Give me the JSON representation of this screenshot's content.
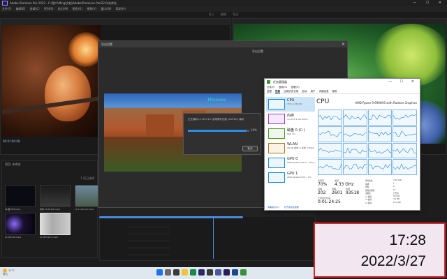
{
  "premiere": {
    "title": "Adobe Premiere Pro 2022 - C:\\用户\\Ming\\文档\\Adobe\\Premiere Pro\\22.0\\未命名",
    "window_buttons": "— ☐ ✕",
    "menu": [
      "文件(F)",
      "编辑(E)",
      "剪辑(C)",
      "序列(S)",
      "标记(M)",
      "图形(G)",
      "视图(V)",
      "窗口(W)",
      "帮助(H)"
    ],
    "workspaces": [
      "导入",
      "编辑",
      "导出"
    ],
    "source_timecode": "00:01:00:08",
    "project_title": "项目: 未命名",
    "item_count": "1 项已选择",
    "thumbs": [
      {
        "label": "IN-图.VEO.mp4"
      },
      {
        "label": "蒙版 LR-IM.JPG.mp4"
      },
      {
        "label": "YL-1 LR1 sim.mp4"
      },
      {
        "label": "LC-IM-V16.mp4"
      },
      {
        "label": "LC-IM-V16-2.mp4"
      }
    ]
  },
  "export_dialog": {
    "title": "导出设置",
    "close": "✕",
    "image_logo": "Hisense",
    "right_header": "导出设置"
  },
  "encoding": {
    "title": "正在编码 LC-IM-V16: 使用硬件加速 (NVENC) 编码",
    "percent_text": "18%",
    "progress": 0.96,
    "cancel": "取消"
  },
  "taskmgr": {
    "title": "任务管理器",
    "window_buttons": "— ☐ ✕",
    "menu": [
      "文件(F)",
      "选项(O)",
      "查看(V)"
    ],
    "tabs": [
      "进程",
      "性能",
      "应用历史记录",
      "启动",
      "用户",
      "详细信息",
      "服务"
    ],
    "active_tab": 1,
    "side": [
      {
        "name": "CPU",
        "sub": "70%  4.33 GHz",
        "kind": "cpu"
      },
      {
        "name": "内存",
        "sub": "12.0/15.2 GB (80%)",
        "kind": "mem"
      },
      {
        "name": "磁盘 0 (C:)",
        "sub": "SSD\n1%",
        "kind": "disk"
      },
      {
        "name": "WLAN",
        "sub": "WLAN\n发送: 0 接收: 0 Kbps",
        "kind": "wlan"
      },
      {
        "name": "GPU 0",
        "sub": "AMD Radeon RX 6...\n15% (75 °C)",
        "kind": "gpu"
      },
      {
        "name": "GPU 1",
        "sub": "AMD Radeon(TM)...\n1%",
        "kind": "gpu"
      }
    ],
    "cpu_header": "CPU",
    "cpu_name": "AMD Ryzen 9 6900HS with Radeon Graphics",
    "stats": {
      "util_label": "利用率",
      "util": "70%",
      "speed_label": "速度",
      "speed": "4.33 GHz",
      "proc_label": "进程",
      "proc": "202",
      "threads_label": "线程",
      "threads": "2601",
      "handles_label": "句柄",
      "handles": "93518",
      "uptime_label": "正常运行时间",
      "uptime": "0:01:24:25"
    },
    "specs": [
      [
        "基准速度:",
        "3.30 GHz"
      ],
      [
        "插槽:",
        "1"
      ],
      [
        "内核:",
        "8"
      ],
      [
        "逻辑处理器:",
        "16"
      ],
      [
        "虚拟化:",
        "已启用"
      ],
      [
        "L1 缓存:",
        "512 KB"
      ],
      [
        "L2 缓存:",
        "4.0 MB"
      ],
      [
        "L3 缓存:",
        "16.0 MB"
      ]
    ],
    "footer_less": "简略信息(D)",
    "footer_monitor": "打开资源监视器"
  },
  "clock": {
    "time": "17:28",
    "date": "2022/3/27"
  },
  "taskbar": {
    "temp": "11°C",
    "weather": "多云"
  },
  "colors": {
    "accent": "#2d8ceb",
    "highlight_border": "#d62828"
  }
}
